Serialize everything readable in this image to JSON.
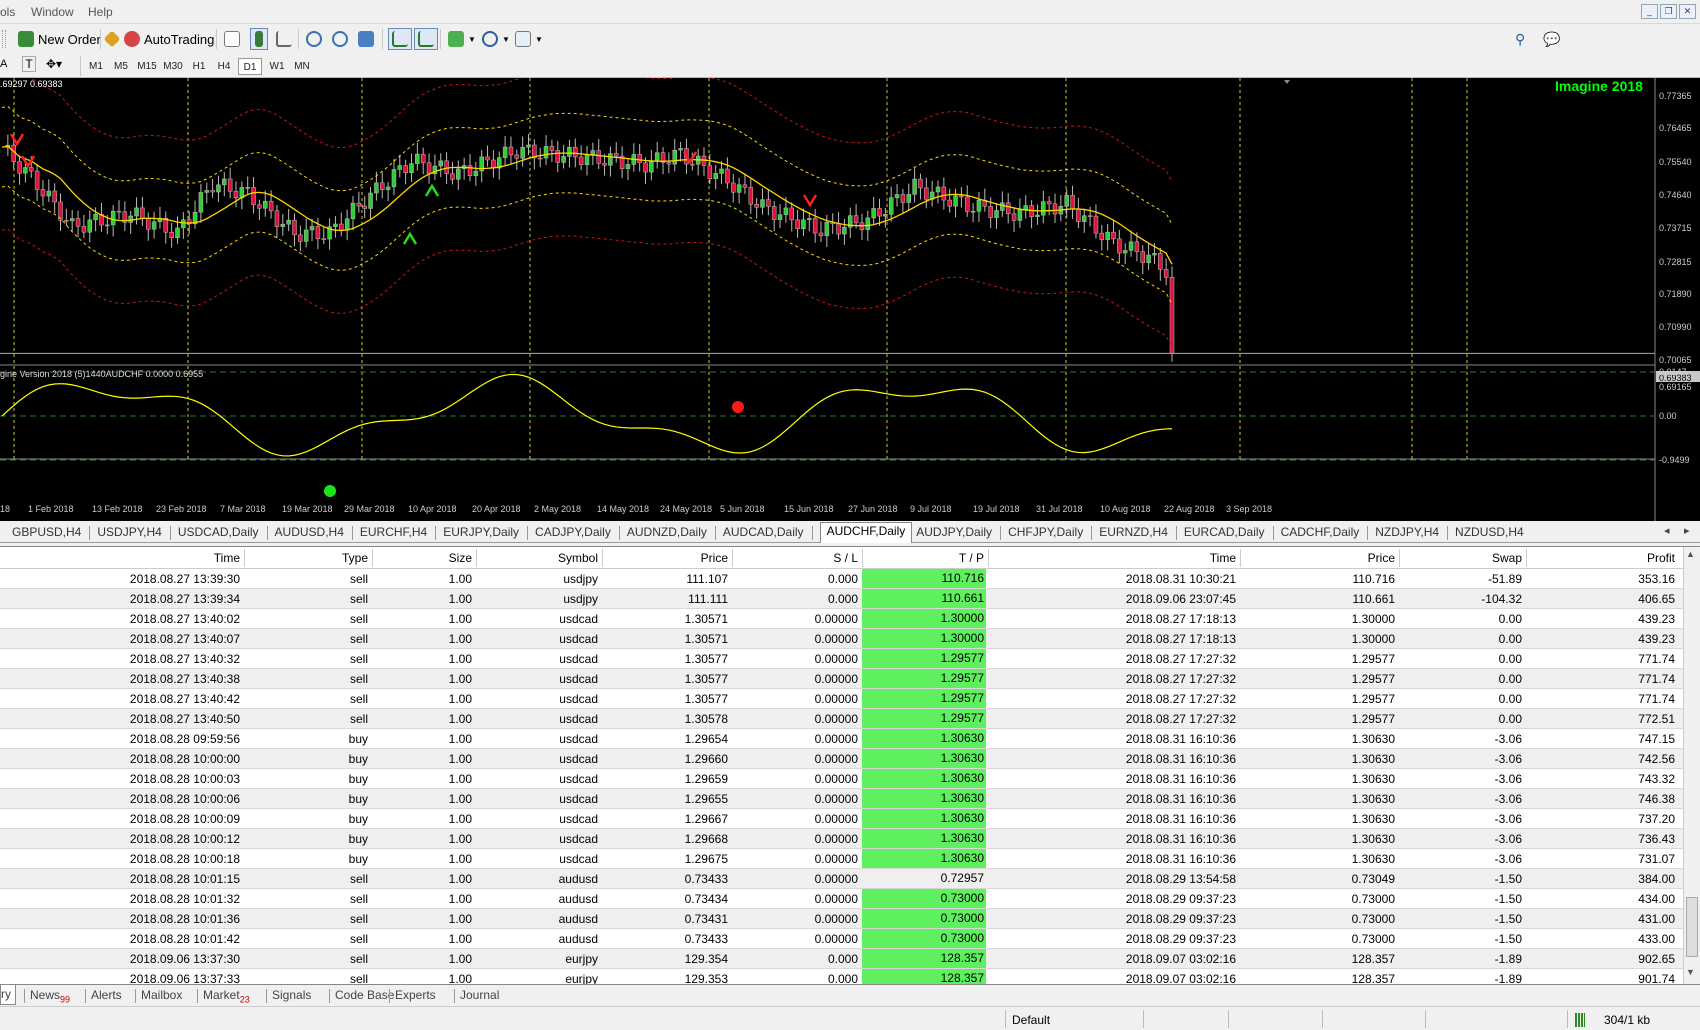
{
  "menu": {
    "items": [
      "ols",
      "Window",
      "Help"
    ]
  },
  "toolbar": {
    "new_order": "New Order",
    "autotrading": "AutoTrading"
  },
  "timeframes": [
    "M1",
    "M5",
    "M15",
    "M30",
    "H1",
    "H4",
    "D1",
    "W1",
    "MN"
  ],
  "timeframe_selected": "D1",
  "chart": {
    "header_text": ".69297 0.69383",
    "brand_label": "Imagine 2018",
    "indicator_label": "gine Version 2018 (5)1440AUDCHF 0.0000 0.6955",
    "price_ticks": [
      "0.77365",
      "0.76465",
      "0.75540",
      "0.74640",
      "0.73715",
      "0.72815",
      "0.71890",
      "0.70990",
      "0.70065",
      "0.69383",
      "0.69165"
    ],
    "indicator_ticks": [
      "0.9147",
      "0.00",
      "-0.9499"
    ],
    "date_ticks": [
      "18",
      "1 Feb 2018",
      "13 Feb 2018",
      "23 Feb 2018",
      "7 Mar 2018",
      "19 Mar 2018",
      "29 Mar 2018",
      "10 Apr 2018",
      "20 Apr 2018",
      "2 May 2018",
      "14 May 2018",
      "24 May 2018",
      "5 Jun 2018",
      "15 Jun 2018",
      "27 Jun 2018",
      "9 Jul 2018",
      "19 Jul 2018",
      "31 Jul 2018",
      "10 Aug 2018",
      "22 Aug 2018",
      "3 Sep 2018"
    ],
    "colors": {
      "background": "#000000",
      "bull": "#32cd32",
      "bear": "#dc143c",
      "band_inner": "#ffd700",
      "band_outer": "#c81414",
      "brand": "#00ff00",
      "oscillator": "#ffff00"
    }
  },
  "chart_tabs": [
    "GBPUSD,H4",
    "USDJPY,H4",
    "USDCAD,Daily",
    "AUDUSD,H4",
    "EURCHF,H4",
    "EURJPY,Daily",
    "CADJPY,Daily",
    "AUDNZD,Daily",
    "AUDCAD,Daily",
    "AUDCHF,Daily",
    "AUDJPY,Daily",
    "CHFJPY,Daily",
    "EURNZD,H4",
    "EURCAD,Daily",
    "CADCHF,Daily",
    "NZDJPY,H4",
    "NZDUSD,H4"
  ],
  "chart_tab_selected": "AUDCHF,Daily",
  "table": {
    "columns": [
      "Time",
      "Type",
      "Size",
      "Symbol",
      "Price",
      "S / L",
      "T / P",
      "Time",
      "Price",
      "Swap",
      "Profit"
    ],
    "rows": [
      [
        "2018.08.27 13:39:30",
        "sell",
        "1.00",
        "usdjpy",
        "111.107",
        "0.000",
        "110.716",
        "2018.08.31 10:30:21",
        "110.716",
        "-51.89",
        "353.16",
        true
      ],
      [
        "2018.08.27 13:39:34",
        "sell",
        "1.00",
        "usdjpy",
        "111.111",
        "0.000",
        "110.661",
        "2018.09.06 23:07:45",
        "110.661",
        "-104.32",
        "406.65",
        true
      ],
      [
        "2018.08.27 13:40:02",
        "sell",
        "1.00",
        "usdcad",
        "1.30571",
        "0.00000",
        "1.30000",
        "2018.08.27 17:18:13",
        "1.30000",
        "0.00",
        "439.23",
        true
      ],
      [
        "2018.08.27 13:40:07",
        "sell",
        "1.00",
        "usdcad",
        "1.30571",
        "0.00000",
        "1.30000",
        "2018.08.27 17:18:13",
        "1.30000",
        "0.00",
        "439.23",
        true
      ],
      [
        "2018.08.27 13:40:32",
        "sell",
        "1.00",
        "usdcad",
        "1.30577",
        "0.00000",
        "1.29577",
        "2018.08.27 17:27:32",
        "1.29577",
        "0.00",
        "771.74",
        true
      ],
      [
        "2018.08.27 13:40:38",
        "sell",
        "1.00",
        "usdcad",
        "1.30577",
        "0.00000",
        "1.29577",
        "2018.08.27 17:27:32",
        "1.29577",
        "0.00",
        "771.74",
        true
      ],
      [
        "2018.08.27 13:40:42",
        "sell",
        "1.00",
        "usdcad",
        "1.30577",
        "0.00000",
        "1.29577",
        "2018.08.27 17:27:32",
        "1.29577",
        "0.00",
        "771.74",
        true
      ],
      [
        "2018.08.27 13:40:50",
        "sell",
        "1.00",
        "usdcad",
        "1.30578",
        "0.00000",
        "1.29577",
        "2018.08.27 17:27:32",
        "1.29577",
        "0.00",
        "772.51",
        true
      ],
      [
        "2018.08.28 09:59:56",
        "buy",
        "1.00",
        "usdcad",
        "1.29654",
        "0.00000",
        "1.30630",
        "2018.08.31 16:10:36",
        "1.30630",
        "-3.06",
        "747.15",
        true
      ],
      [
        "2018.08.28 10:00:00",
        "buy",
        "1.00",
        "usdcad",
        "1.29660",
        "0.00000",
        "1.30630",
        "2018.08.31 16:10:36",
        "1.30630",
        "-3.06",
        "742.56",
        true
      ],
      [
        "2018.08.28 10:00:03",
        "buy",
        "1.00",
        "usdcad",
        "1.29659",
        "0.00000",
        "1.30630",
        "2018.08.31 16:10:36",
        "1.30630",
        "-3.06",
        "743.32",
        true
      ],
      [
        "2018.08.28 10:00:06",
        "buy",
        "1.00",
        "usdcad",
        "1.29655",
        "0.00000",
        "1.30630",
        "2018.08.31 16:10:36",
        "1.30630",
        "-3.06",
        "746.38",
        true
      ],
      [
        "2018.08.28 10:00:09",
        "buy",
        "1.00",
        "usdcad",
        "1.29667",
        "0.00000",
        "1.30630",
        "2018.08.31 16:10:36",
        "1.30630",
        "-3.06",
        "737.20",
        true
      ],
      [
        "2018.08.28 10:00:12",
        "buy",
        "1.00",
        "usdcad",
        "1.29668",
        "0.00000",
        "1.30630",
        "2018.08.31 16:10:36",
        "1.30630",
        "-3.06",
        "736.43",
        true
      ],
      [
        "2018.08.28 10:00:18",
        "buy",
        "1.00",
        "usdcad",
        "1.29675",
        "0.00000",
        "1.30630",
        "2018.08.31 16:10:36",
        "1.30630",
        "-3.06",
        "731.07",
        true
      ],
      [
        "2018.08.28 10:01:15",
        "sell",
        "1.00",
        "audusd",
        "0.73433",
        "0.00000",
        "0.72957",
        "2018.08.29 13:54:58",
        "0.73049",
        "-1.50",
        "384.00",
        false
      ],
      [
        "2018.08.28 10:01:32",
        "sell",
        "1.00",
        "audusd",
        "0.73434",
        "0.00000",
        "0.73000",
        "2018.08.29 09:37:23",
        "0.73000",
        "-1.50",
        "434.00",
        true
      ],
      [
        "2018.08.28 10:01:36",
        "sell",
        "1.00",
        "audusd",
        "0.73431",
        "0.00000",
        "0.73000",
        "2018.08.29 09:37:23",
        "0.73000",
        "-1.50",
        "431.00",
        true
      ],
      [
        "2018.08.28 10:01:42",
        "sell",
        "1.00",
        "audusd",
        "0.73433",
        "0.00000",
        "0.73000",
        "2018.08.29 09:37:23",
        "0.73000",
        "-1.50",
        "433.00",
        true
      ],
      [
        "2018.09.06 13:37:30",
        "sell",
        "1.00",
        "eurjpy",
        "129.354",
        "0.000",
        "128.357",
        "2018.09.07 03:02:16",
        "128.357",
        "-1.89",
        "902.65",
        true
      ],
      [
        "2018.09.06 13:37:33",
        "sell",
        "1.00",
        "eurjpy",
        "129.353",
        "0.000",
        "128.357",
        "2018.09.07 03:02:16",
        "128.357",
        "-1.89",
        "901.74",
        true
      ]
    ]
  },
  "bottom_tabs": [
    {
      "label": "ry"
    },
    {
      "label": "News",
      "count": "99"
    },
    {
      "label": "Alerts"
    },
    {
      "label": "Mailbox"
    },
    {
      "label": "Market",
      "count": "23"
    },
    {
      "label": "Signals"
    },
    {
      "label": "Code Base"
    },
    {
      "label": "Experts"
    },
    {
      "label": "Journal"
    }
  ],
  "status": {
    "profile": "Default",
    "traffic": "304/1 kb"
  }
}
